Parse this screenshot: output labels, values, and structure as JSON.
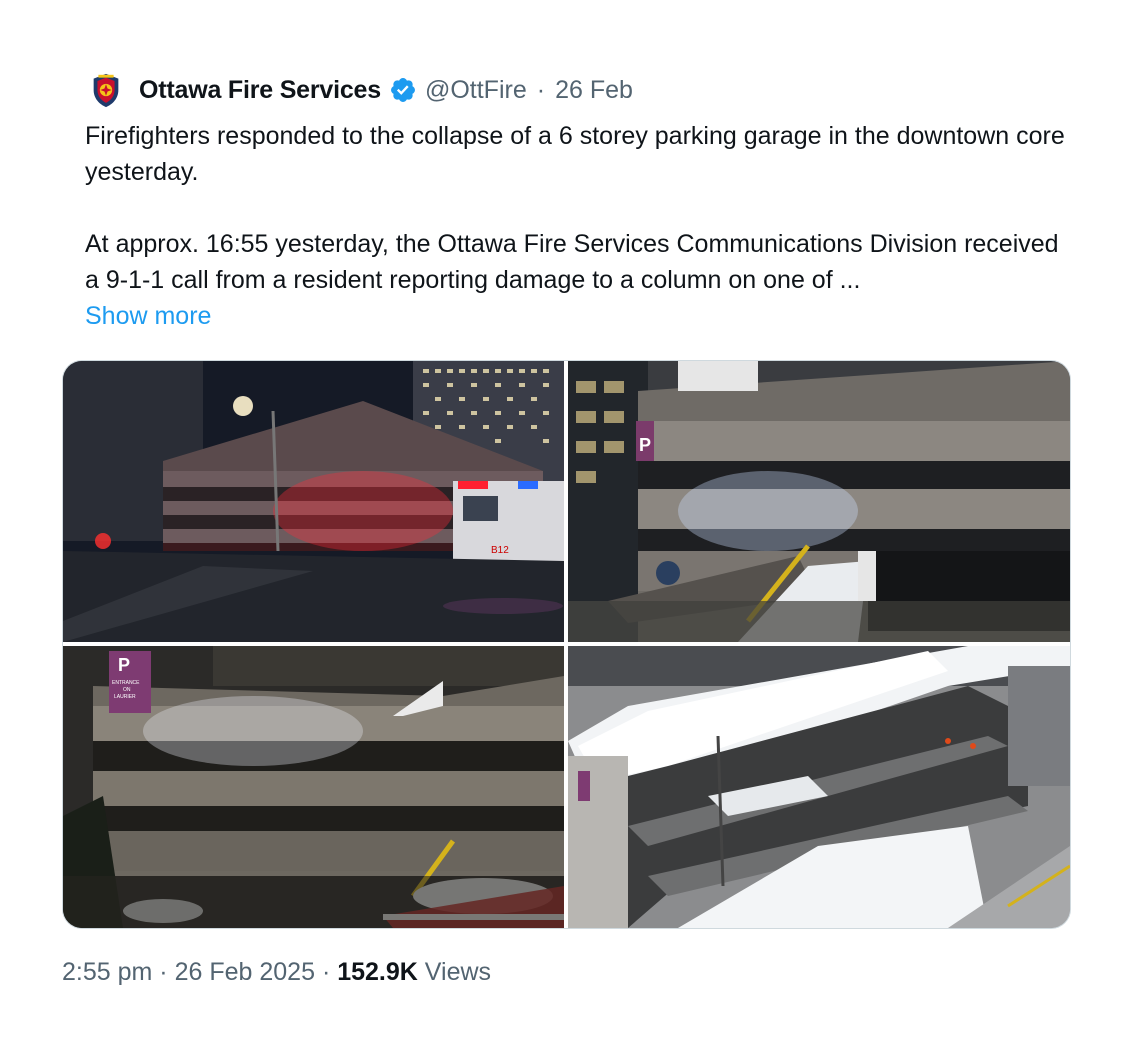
{
  "tweet": {
    "author_name": "Ottawa Fire Services",
    "handle": "@OttFire",
    "separator": "·",
    "date": "26 Feb",
    "verified": true,
    "avatar_icon": "ottawa-fire-badge-icon",
    "paragraph1": "Firefighters responded to the collapse of a 6 storey parking garage in the downtown core yesterday.",
    "paragraph2": "At approx. 16:55 yesterday, the Ottawa Fire Services Communications Division received a 9-1-1 call from a resident reporting damage to a column on one of  ...",
    "show_more": "Show more",
    "media": [
      {
        "kind": "photo",
        "description_icon": "night-street-garage-fire-truck-photo"
      },
      {
        "kind": "photo",
        "description_icon": "collapsed-ramp-closeup-photo"
      },
      {
        "kind": "photo",
        "description_icon": "garage-facade-entrance-sign-photo"
      },
      {
        "kind": "photo",
        "description_icon": "aerial-collapsed-decks-snow-photo"
      }
    ],
    "media_signs": {
      "parking_letter": "P",
      "entrance_sign": [
        "ENTRANCE",
        "ON",
        "LAURIER"
      ],
      "truck_number": "B12"
    },
    "footer": {
      "time": "2:55 pm",
      "sep1": "·",
      "full_date": "26 Feb 2025",
      "sep2": "·",
      "views_count": "152.9K",
      "views_label": "Views"
    }
  },
  "colors": {
    "text_primary": "#0f1419",
    "text_secondary": "#536471",
    "link": "#1d9bf0",
    "verified": "#1d9bf0"
  }
}
